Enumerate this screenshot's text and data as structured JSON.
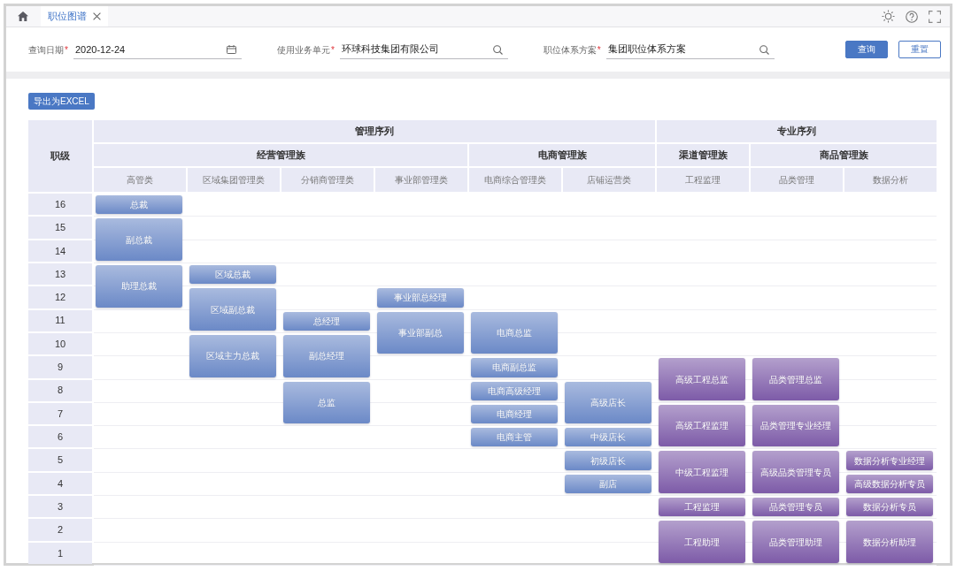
{
  "tabs": [
    {
      "label": "职位图谱",
      "selected": true
    }
  ],
  "filters": [
    {
      "kind": "date",
      "label": "查询日期",
      "required_mark": "*",
      "value": "2020-12-24"
    },
    {
      "kind": "lookup",
      "label": "使用业务单元",
      "required_mark": "*",
      "value": "环球科技集团有限公司"
    },
    {
      "kind": "lookup",
      "label": "职位体系方案",
      "required_mark": "*",
      "value": "集团职位体系方案"
    }
  ],
  "buttons": [
    {
      "kind": "primary",
      "label": "查询"
    },
    {
      "kind": "outline",
      "label": "重置"
    }
  ],
  "export_button": "导出为EXCEL",
  "grid": {
    "grade_header": "职级",
    "sequences": [
      {
        "name": "管理序列",
        "color": "#6b89c7",
        "families": [
          {
            "name": "经营管理族",
            "categories": [
              "高管类",
              "区域集团管理类",
              "分销商管理类",
              "事业部管理类"
            ]
          },
          {
            "name": "电商管理族",
            "categories": [
              "电商综合管理类",
              "店铺运营类"
            ]
          }
        ]
      },
      {
        "name": "专业序列",
        "color": "#7d5ba8",
        "families": [
          {
            "name": "渠道管理族",
            "categories": [
              "工程监理"
            ]
          },
          {
            "name": "商品管理族",
            "categories": [
              "品类管理",
              "数据分析"
            ]
          }
        ]
      }
    ],
    "rows": [
      {
        "grade": "16",
        "cells": [
          {
            "kind": "position",
            "title": "总裁"
          },
          {
            "kind": "none"
          },
          {
            "kind": "none"
          },
          {
            "kind": "none"
          },
          {
            "kind": "none"
          },
          {
            "kind": "none"
          },
          {
            "kind": "none"
          },
          {
            "kind": "none"
          },
          {
            "kind": "none"
          }
        ]
      },
      {
        "grade": "15",
        "cells": [
          {
            "kind": "position",
            "title": "副总裁"
          },
          {
            "kind": "none"
          },
          {
            "kind": "none"
          },
          {
            "kind": "none"
          },
          {
            "kind": "none"
          },
          {
            "kind": "none"
          },
          {
            "kind": "none"
          },
          {
            "kind": "none"
          },
          {
            "kind": "none"
          }
        ]
      },
      {
        "grade": "14",
        "cells": [
          {
            "kind": "merged"
          },
          {
            "kind": "none"
          },
          {
            "kind": "none"
          },
          {
            "kind": "none"
          },
          {
            "kind": "none"
          },
          {
            "kind": "none"
          },
          {
            "kind": "none"
          },
          {
            "kind": "none"
          },
          {
            "kind": "none"
          }
        ]
      },
      {
        "grade": "13",
        "cells": [
          {
            "kind": "position",
            "title": "助理总裁"
          },
          {
            "kind": "position",
            "title": "区域总裁"
          },
          {
            "kind": "none"
          },
          {
            "kind": "none"
          },
          {
            "kind": "none"
          },
          {
            "kind": "none"
          },
          {
            "kind": "none"
          },
          {
            "kind": "none"
          },
          {
            "kind": "none"
          }
        ]
      },
      {
        "grade": "12",
        "cells": [
          {
            "kind": "merged"
          },
          {
            "kind": "position",
            "title": "区域副总裁"
          },
          {
            "kind": "none"
          },
          {
            "kind": "position",
            "title": "事业部总经理"
          },
          {
            "kind": "none"
          },
          {
            "kind": "none"
          },
          {
            "kind": "none"
          },
          {
            "kind": "none"
          },
          {
            "kind": "none"
          }
        ]
      },
      {
        "grade": "11",
        "cells": [
          {
            "kind": "none"
          },
          {
            "kind": "merged"
          },
          {
            "kind": "position",
            "title": "总经理"
          },
          {
            "kind": "position",
            "title": "事业部副总"
          },
          {
            "kind": "position",
            "title": "电商总监"
          },
          {
            "kind": "none"
          },
          {
            "kind": "none"
          },
          {
            "kind": "none"
          },
          {
            "kind": "none"
          }
        ]
      },
      {
        "grade": "10",
        "cells": [
          {
            "kind": "none"
          },
          {
            "kind": "position",
            "title": "区域主力总裁"
          },
          {
            "kind": "position",
            "title": "副总经理"
          },
          {
            "kind": "merged"
          },
          {
            "kind": "merged"
          },
          {
            "kind": "none"
          },
          {
            "kind": "none"
          },
          {
            "kind": "none"
          },
          {
            "kind": "none"
          }
        ]
      },
      {
        "grade": "9",
        "cells": [
          {
            "kind": "none"
          },
          {
            "kind": "merged"
          },
          {
            "kind": "merged"
          },
          {
            "kind": "none"
          },
          {
            "kind": "position",
            "title": "电商副总监"
          },
          {
            "kind": "none"
          },
          {
            "kind": "position",
            "title": "高级工程总监"
          },
          {
            "kind": "position",
            "title": "品类管理总监"
          },
          {
            "kind": "none"
          }
        ]
      },
      {
        "grade": "8",
        "cells": [
          {
            "kind": "none"
          },
          {
            "kind": "none"
          },
          {
            "kind": "position",
            "title": "总监"
          },
          {
            "kind": "none"
          },
          {
            "kind": "position",
            "title": "电商高级经理"
          },
          {
            "kind": "position",
            "title": "高级店长"
          },
          {
            "kind": "merged"
          },
          {
            "kind": "merged"
          },
          {
            "kind": "none"
          }
        ]
      },
      {
        "grade": "7",
        "cells": [
          {
            "kind": "none"
          },
          {
            "kind": "none"
          },
          {
            "kind": "merged"
          },
          {
            "kind": "none"
          },
          {
            "kind": "position",
            "title": "电商经理"
          },
          {
            "kind": "merged"
          },
          {
            "kind": "position",
            "title": "高级工程监理"
          },
          {
            "kind": "position",
            "title": "品类管理专业经理"
          },
          {
            "kind": "none"
          }
        ]
      },
      {
        "grade": "6",
        "cells": [
          {
            "kind": "none"
          },
          {
            "kind": "none"
          },
          {
            "kind": "none"
          },
          {
            "kind": "none"
          },
          {
            "kind": "position",
            "title": "电商主管"
          },
          {
            "kind": "position",
            "title": "中级店长"
          },
          {
            "kind": "merged"
          },
          {
            "kind": "merged"
          },
          {
            "kind": "none"
          }
        ]
      },
      {
        "grade": "5",
        "cells": [
          {
            "kind": "none"
          },
          {
            "kind": "none"
          },
          {
            "kind": "none"
          },
          {
            "kind": "none"
          },
          {
            "kind": "none"
          },
          {
            "kind": "position",
            "title": "初级店长"
          },
          {
            "kind": "position",
            "title": "中级工程监理"
          },
          {
            "kind": "position",
            "title": "高级品类管理专员"
          },
          {
            "kind": "position",
            "title": "数据分析专业经理"
          }
        ]
      },
      {
        "grade": "4",
        "cells": [
          {
            "kind": "none"
          },
          {
            "kind": "none"
          },
          {
            "kind": "none"
          },
          {
            "kind": "none"
          },
          {
            "kind": "none"
          },
          {
            "kind": "position",
            "title": "副店"
          },
          {
            "kind": "merged"
          },
          {
            "kind": "merged"
          },
          {
            "kind": "position",
            "title": "高级数据分析专员"
          }
        ]
      },
      {
        "grade": "3",
        "cells": [
          {
            "kind": "none"
          },
          {
            "kind": "none"
          },
          {
            "kind": "none"
          },
          {
            "kind": "none"
          },
          {
            "kind": "none"
          },
          {
            "kind": "none"
          },
          {
            "kind": "position",
            "title": "工程监理"
          },
          {
            "kind": "position",
            "title": "品类管理专员"
          },
          {
            "kind": "position",
            "title": "数据分析专员"
          }
        ]
      },
      {
        "grade": "2",
        "cells": [
          {
            "kind": "none"
          },
          {
            "kind": "none"
          },
          {
            "kind": "none"
          },
          {
            "kind": "none"
          },
          {
            "kind": "none"
          },
          {
            "kind": "none"
          },
          {
            "kind": "position",
            "title": "工程助理"
          },
          {
            "kind": "position",
            "title": "品类管理助理"
          },
          {
            "kind": "position",
            "title": "数据分析助理"
          }
        ]
      },
      {
        "grade": "1",
        "cells": [
          {
            "kind": "none"
          },
          {
            "kind": "none"
          },
          {
            "kind": "none"
          },
          {
            "kind": "none"
          },
          {
            "kind": "none"
          },
          {
            "kind": "none"
          },
          {
            "kind": "merged"
          },
          {
            "kind": "merged"
          },
          {
            "kind": "merged"
          }
        ]
      }
    ]
  }
}
